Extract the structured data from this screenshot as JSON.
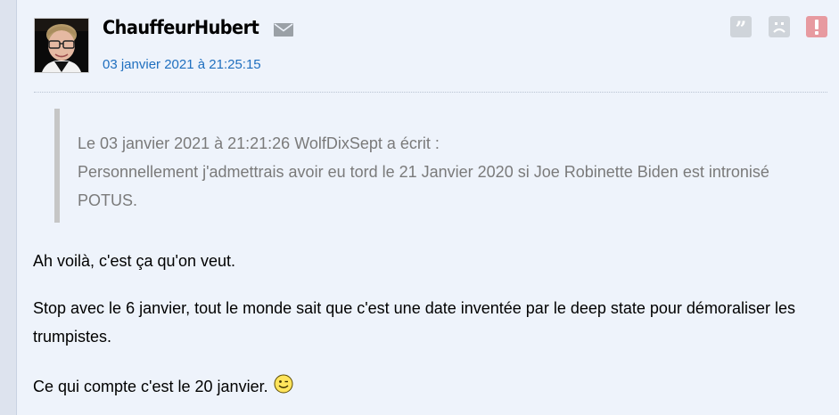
{
  "post": {
    "author": "ChauffeurHubert",
    "date": "03 janvier 2021 à 21:25:15",
    "icons": {
      "mail": "envelope-icon",
      "quote": "quote-icon",
      "sad": "sad-face-icon",
      "alert": "alert-icon"
    },
    "quote": {
      "line1": "Le 03 janvier 2021 à 21:21:26 WolfDixSept a écrit :",
      "line2": "Personnellement j'admettrais avoir eu tord le 21 Janvier 2020 si Joe Robinette Biden est intronisé POTUS."
    },
    "paragraphs": [
      "Ah voilà, c'est ça qu'on veut.",
      "Stop avec le 6 janvier, tout le monde sait que c'est une date inventée par le deep state pour démoraliser les trumpistes.",
      "Ce qui compte c'est le 20 janvier."
    ],
    "colors": {
      "date_link": "#1f6fbf",
      "alert_button": "#e79aa0",
      "quote_text": "#7a7a7a"
    }
  }
}
